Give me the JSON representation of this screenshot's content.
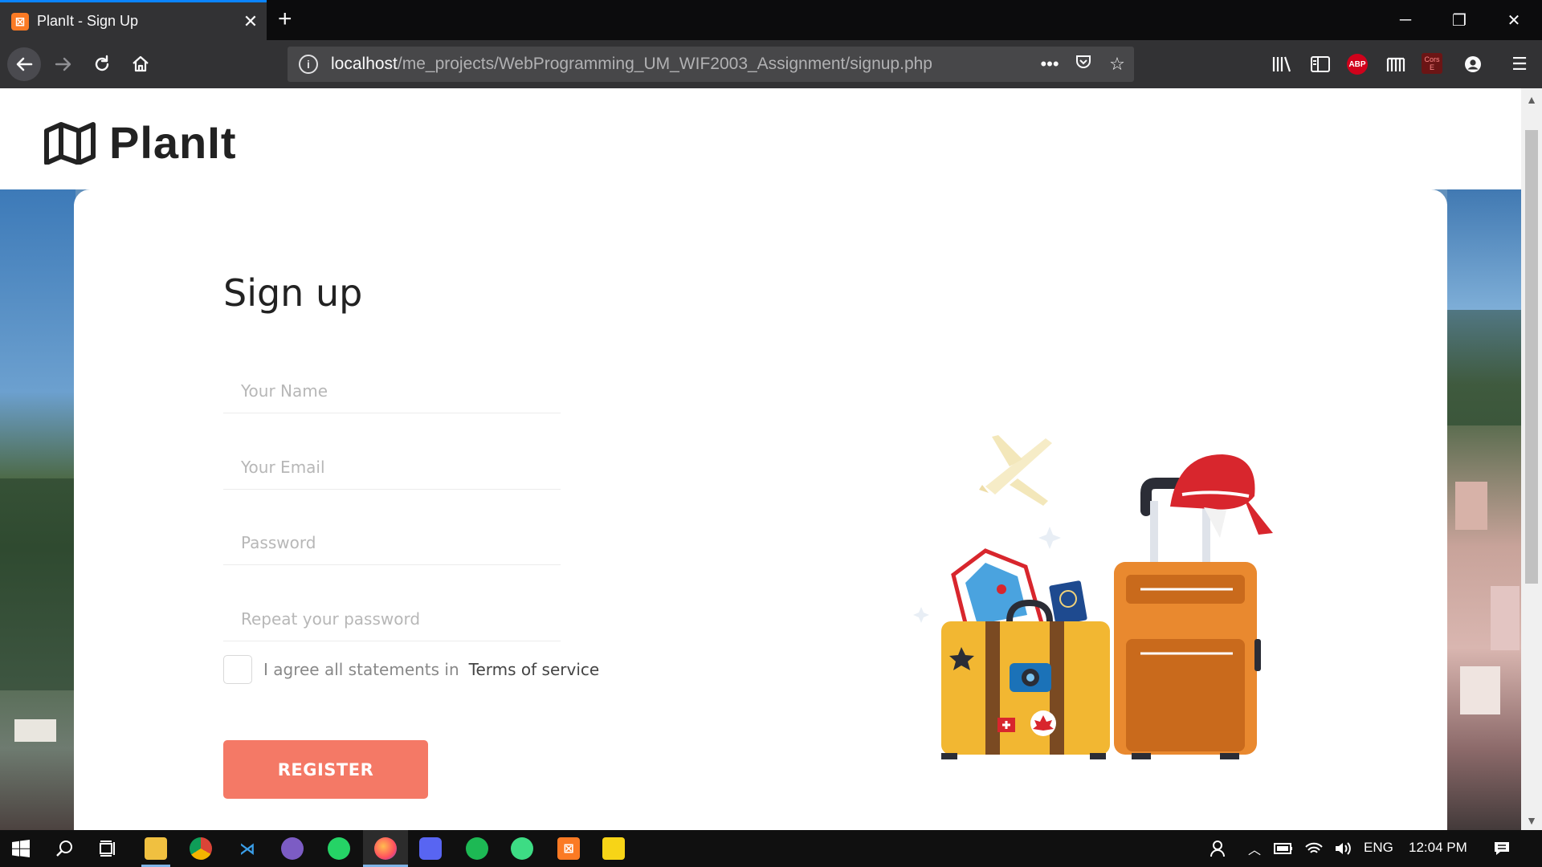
{
  "browser": {
    "tab_title": "PlanIt - Sign Up",
    "tab_favicon": "xampp-icon",
    "url_host": "localhost",
    "url_path": "/me_projects/WebProgramming_UM_WIF2003_Assignment/signup.php",
    "abp_label": "ABP",
    "cors_label": "Cors E",
    "accent_color": "#0a84ff"
  },
  "site": {
    "logo_text": "PlanIt"
  },
  "form": {
    "title": "Sign up",
    "name_placeholder": "Your Name",
    "email_placeholder": "Your Email",
    "password_placeholder": "Password",
    "repeat_password_placeholder": "Repeat your password",
    "agree_text": "I agree all statements in",
    "terms_link": "Terms of service",
    "register_label": "REGISTER",
    "button_color": "#f47966"
  },
  "taskbar": {
    "language": "ENG",
    "time": "12:04 PM"
  }
}
